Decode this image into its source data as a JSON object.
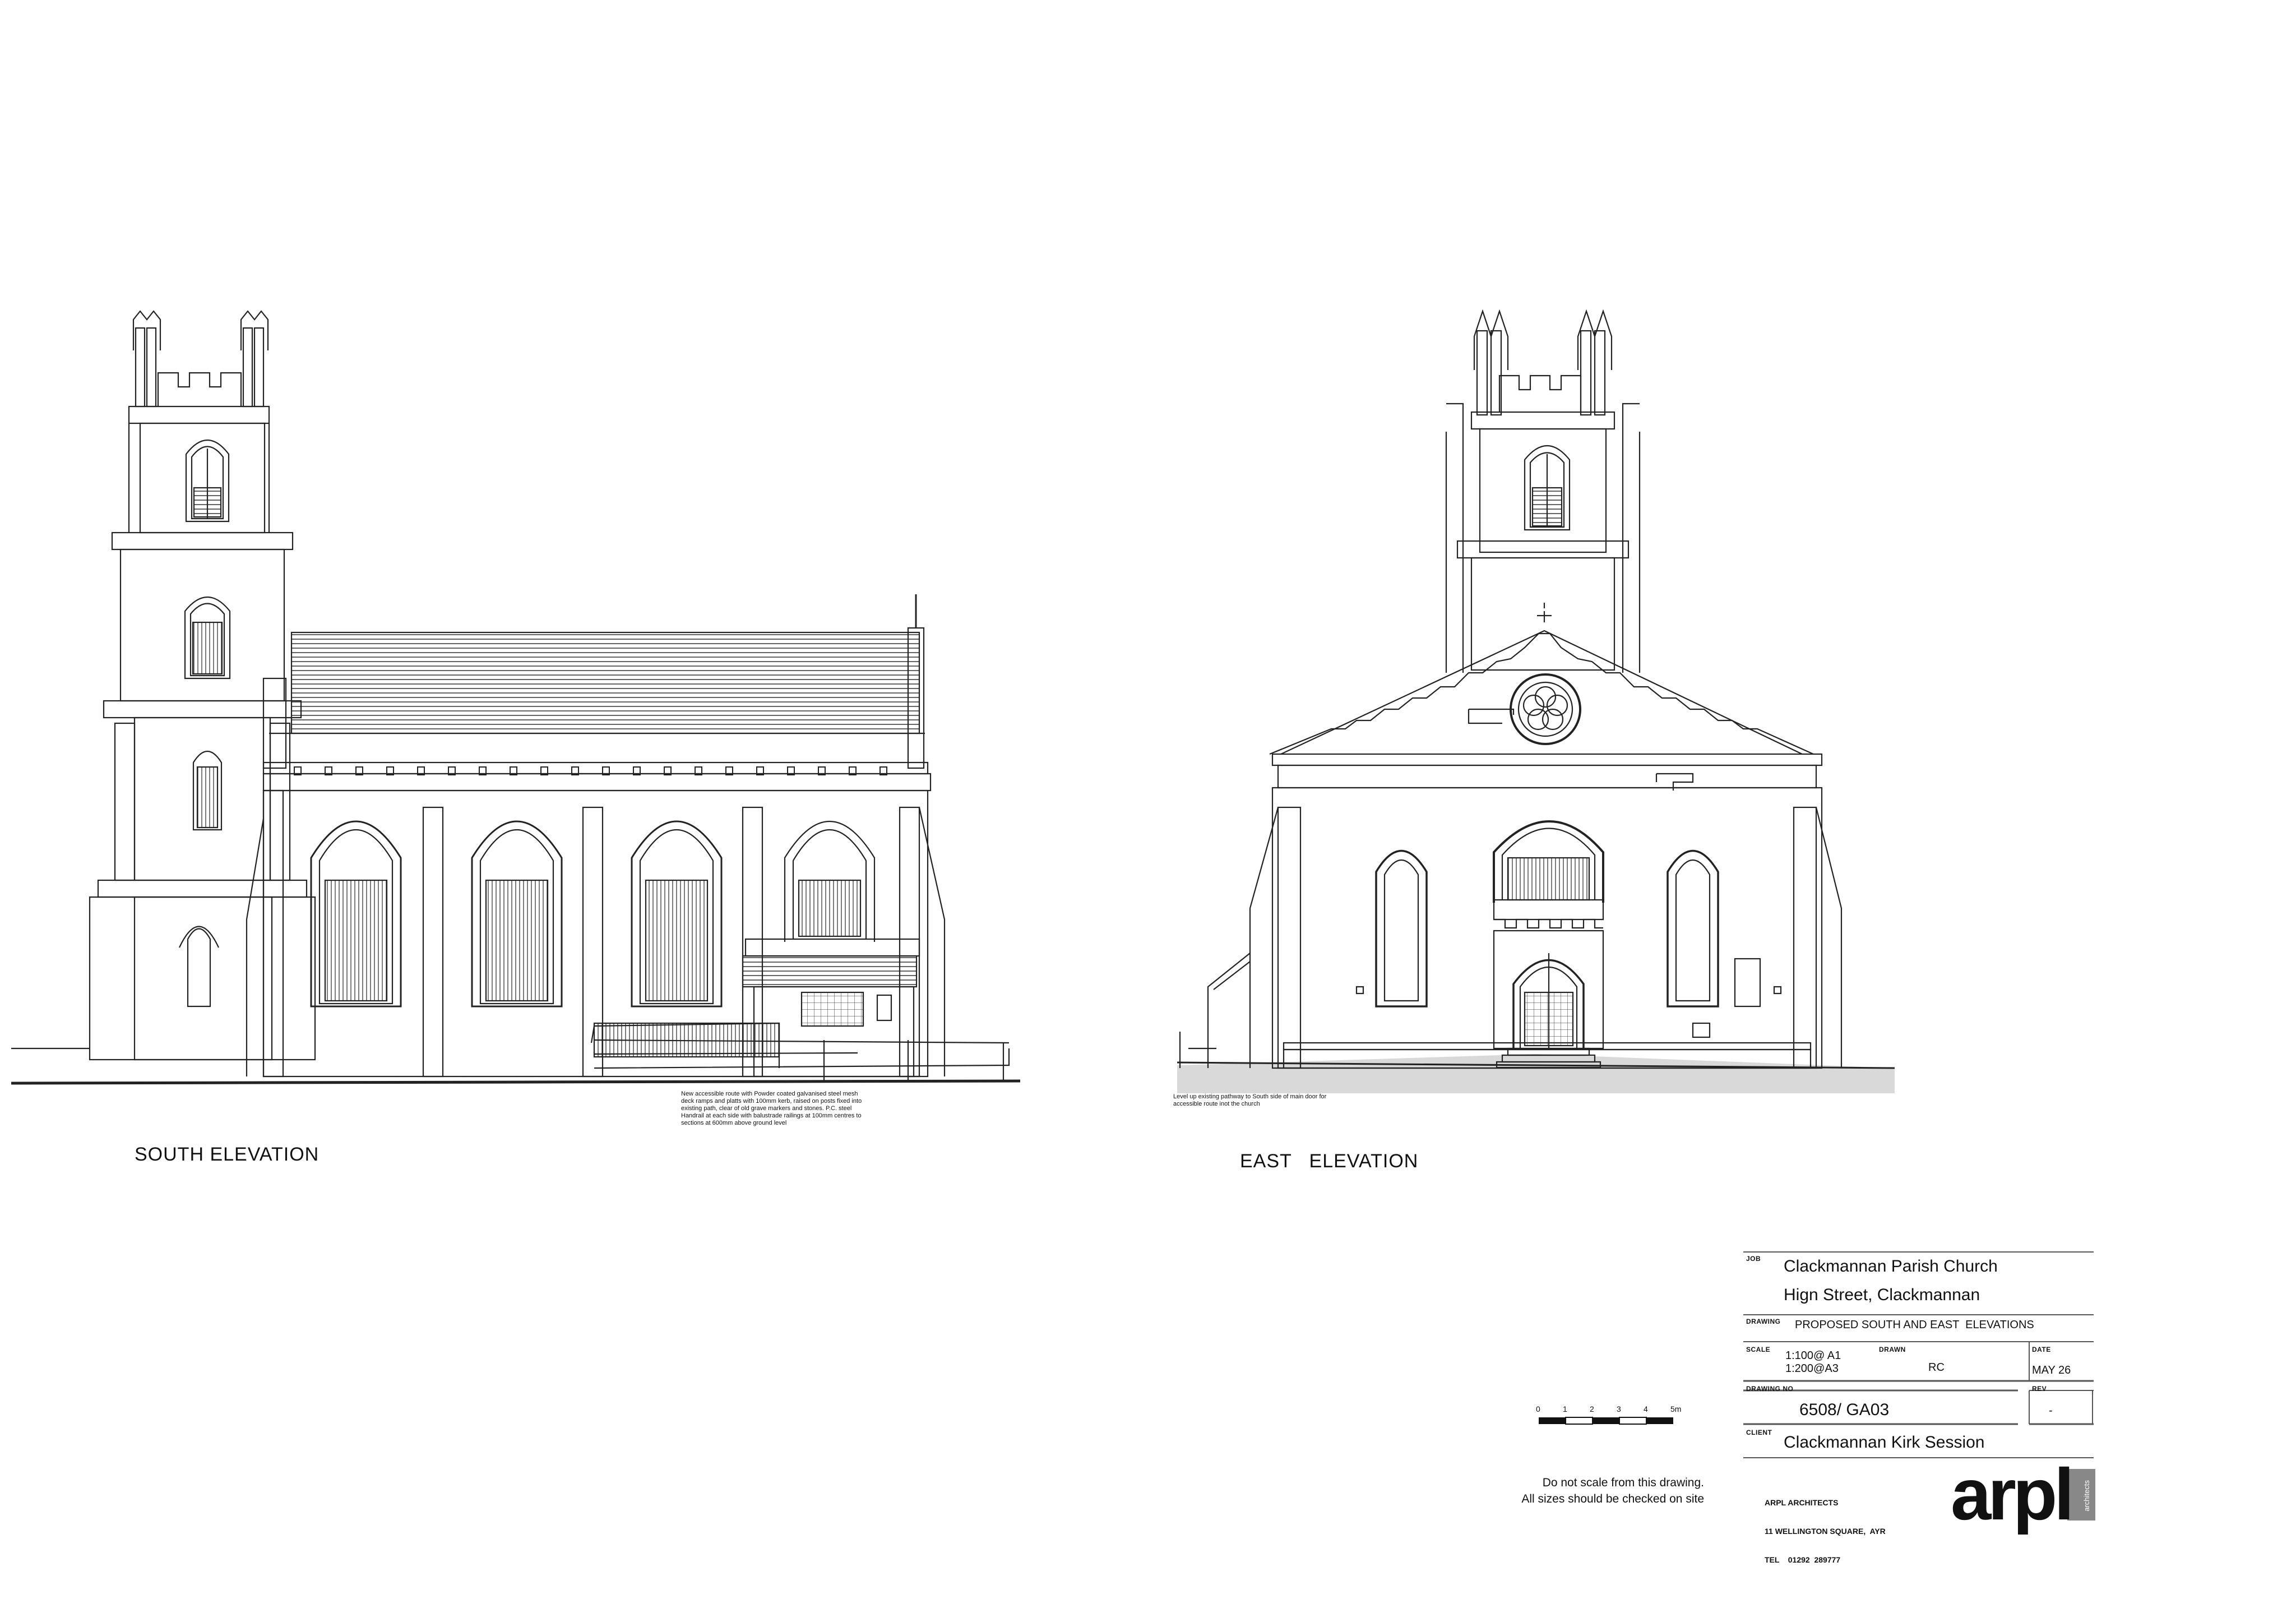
{
  "views": {
    "south": {
      "title": "SOUTH ELEVATION",
      "note": "New accessible route with Powder coated galvanised steel mesh deck ramps and platts with 100mm kerb, raised on posts fixed into existing path, clear of old grave markers and stones. P.C. steel Handrail at each side with balustrade railings at 100mm centres to sections at 600mm above ground level"
    },
    "east": {
      "title": "EAST   ELEVATION",
      "note": "Level up existing pathway to South side of main door for accessible route inot the church"
    }
  },
  "scale_bar": {
    "labels": [
      "0",
      "1",
      "2",
      "3",
      "4",
      "5m"
    ]
  },
  "disclaimer": {
    "line1": "Do not scale from this drawing.",
    "line2": "All sizes should be checked on site"
  },
  "title_block": {
    "job_label": "JOB",
    "job_line1": "Clackmannan Parish Church",
    "job_line2": "Hign Street, Clackmannan",
    "drawing_label": "DRAWING",
    "drawing_value": "PROPOSED SOUTH AND EAST  ELEVATIONS",
    "scale_label": "SCALE",
    "scale_a1": "1:100@ A1",
    "scale_a3": "1:200@A3",
    "drawn_label": "DRAWN",
    "drawn_value": "RC",
    "date_label": "DATE",
    "date_value": "MAY 26",
    "drawing_no_label": "DRAWING NO",
    "drawing_no_value": "6508/ GA03",
    "rev_label": "REV",
    "rev_value": "-",
    "client_label": "CLIENT",
    "client_value": "Clackmannan Kirk Session",
    "firm_line1": "ARPL ARCHITECTS",
    "firm_line2": "11 WELLINGTON SQUARE,  AYR",
    "firm_line3": "TEL    01292  289777",
    "logo_text": "arpl",
    "logo_tag": "architects"
  }
}
